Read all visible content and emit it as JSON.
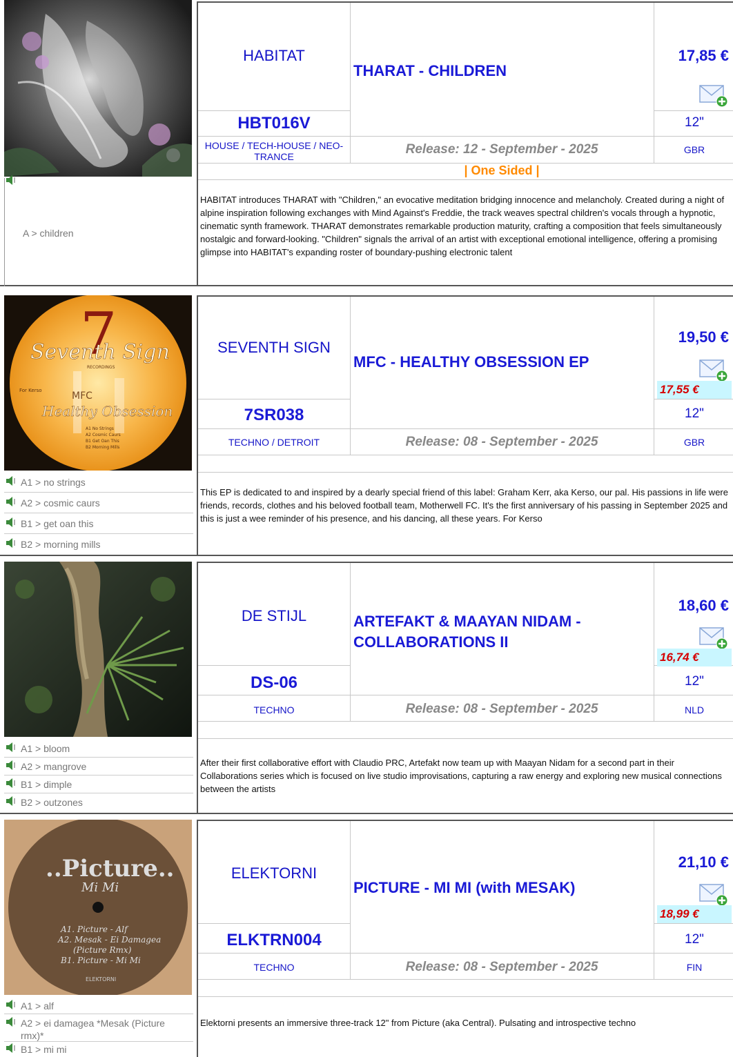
{
  "releases": [
    {
      "label": "HABITAT",
      "title": "THARAT - CHILDREN",
      "price": "17,85 €",
      "discount_price": "",
      "format": "12\"",
      "country": "GBR",
      "catalog": "HBT016V",
      "genre": "HOUSE / TECH-HOUSE / NEO-TRANCE",
      "release_date": "Release: 12 - September - 2025",
      "note": "| One Sided |",
      "tracks": [
        "A > children"
      ],
      "description": "HABITAT introduces THARAT with \"Children,\" an evocative meditation bridging innocence and melancholy. Created during a night of alpine inspiration following exchanges with Mind Against's Freddie, the track weaves spectral children's vocals through a hypnotic, cinematic synth framework. THARAT demonstrates remarkable production maturity, crafting a composition that feels simultaneously nostalgic and forward-looking. \"Children\" signals the arrival of an artist with exceptional emotional intelligence, offering a promising glimpse into HABITAT's expanding roster of boundary-pushing electronic talent"
    },
    {
      "label": "SEVENTH SIGN",
      "title": "MFC - HEALTHY OBSESSION EP",
      "price": "19,50 €",
      "discount_price": "17,55 €",
      "format": "12\"",
      "country": "GBR",
      "catalog": "7SR038",
      "genre": "TECHNO / DETROIT",
      "release_date": "Release: 08 - September - 2025",
      "note": "",
      "tracks": [
        "A1 > no strings",
        "A2 > cosmic caurs",
        "B1 > get oan this",
        "B2 > morning mills"
      ],
      "description": "This EP is dedicated to and inspired by a dearly special friend of this label: Graham Kerr, aka Kerso, our pal. His passions in life were friends, records, clothes and his beloved football team, Motherwell FC. It's the first anniversary of his passing in September 2025 and this is just a wee reminder of his presence, and his dancing, all these years. For Kerso",
      "cover_text": [
        "Seventh Sign",
        "RECORDINGS",
        "MFC",
        "Healthy Obsession",
        "For Kerso",
        "7",
        "A1 No Strings",
        "A2 Cosmic Caurs",
        "B1 Get Oan This",
        "B2 Morning Mills"
      ]
    },
    {
      "label": "DE STIJL",
      "title": "ARTEFAKT & MAAYAN NIDAM - COLLABORATIONS II",
      "price": "18,60 €",
      "discount_price": "16,74 €",
      "format": "12\"",
      "country": "NLD",
      "catalog": "DS-06",
      "genre": "TECHNO",
      "release_date": "Release: 08 - September - 2025",
      "note": "",
      "tracks": [
        "A1 > bloom",
        "A2 > mangrove",
        "B1 > dimple",
        "B2 > outzones"
      ],
      "description": "After their first collaborative effort with Claudio PRC, Artefakt now team up with Maayan Nidam for a second part in their Collaborations series which is focused on live studio improvisations, capturing a raw energy and exploring new musical connections between the artists"
    },
    {
      "label": "ELEKTORNI",
      "title": "PICTURE - MI MI (with MESAK)",
      "price": "21,10 €",
      "discount_price": "18,99 €",
      "format": "12\"",
      "country": "FIN",
      "catalog": "ELKTRN004",
      "genre": "TECHNO",
      "release_date": "Release: 08 - September - 2025",
      "note": "",
      "tracks": [
        "A1 > alf",
        "A2 > ei damagea *Mesak (Picture rmx)*",
        "B1 > mi mi"
      ],
      "description": "Elektorni presents an immersive three-track 12\" from Picture (aka Central). Pulsating and introspective techno",
      "cover_text": [
        "..Picture..",
        "Mi Mi",
        "A1. Picture - Alf",
        "A2. Mesak - Ei Damagea",
        "(Picture Rmx)",
        "B1. Picture - Mi Mi",
        "ELEKTORNI"
      ]
    }
  ],
  "icons": {
    "cart": "mail-envelope-add-icon",
    "play": "speaker-play-icon"
  },
  "colors": {
    "link_blue": "#1515c8",
    "discount_red": "#d60000",
    "discount_bg": "#c9f6ff",
    "note_orange": "#ff8a00",
    "date_gray": "#888888"
  }
}
